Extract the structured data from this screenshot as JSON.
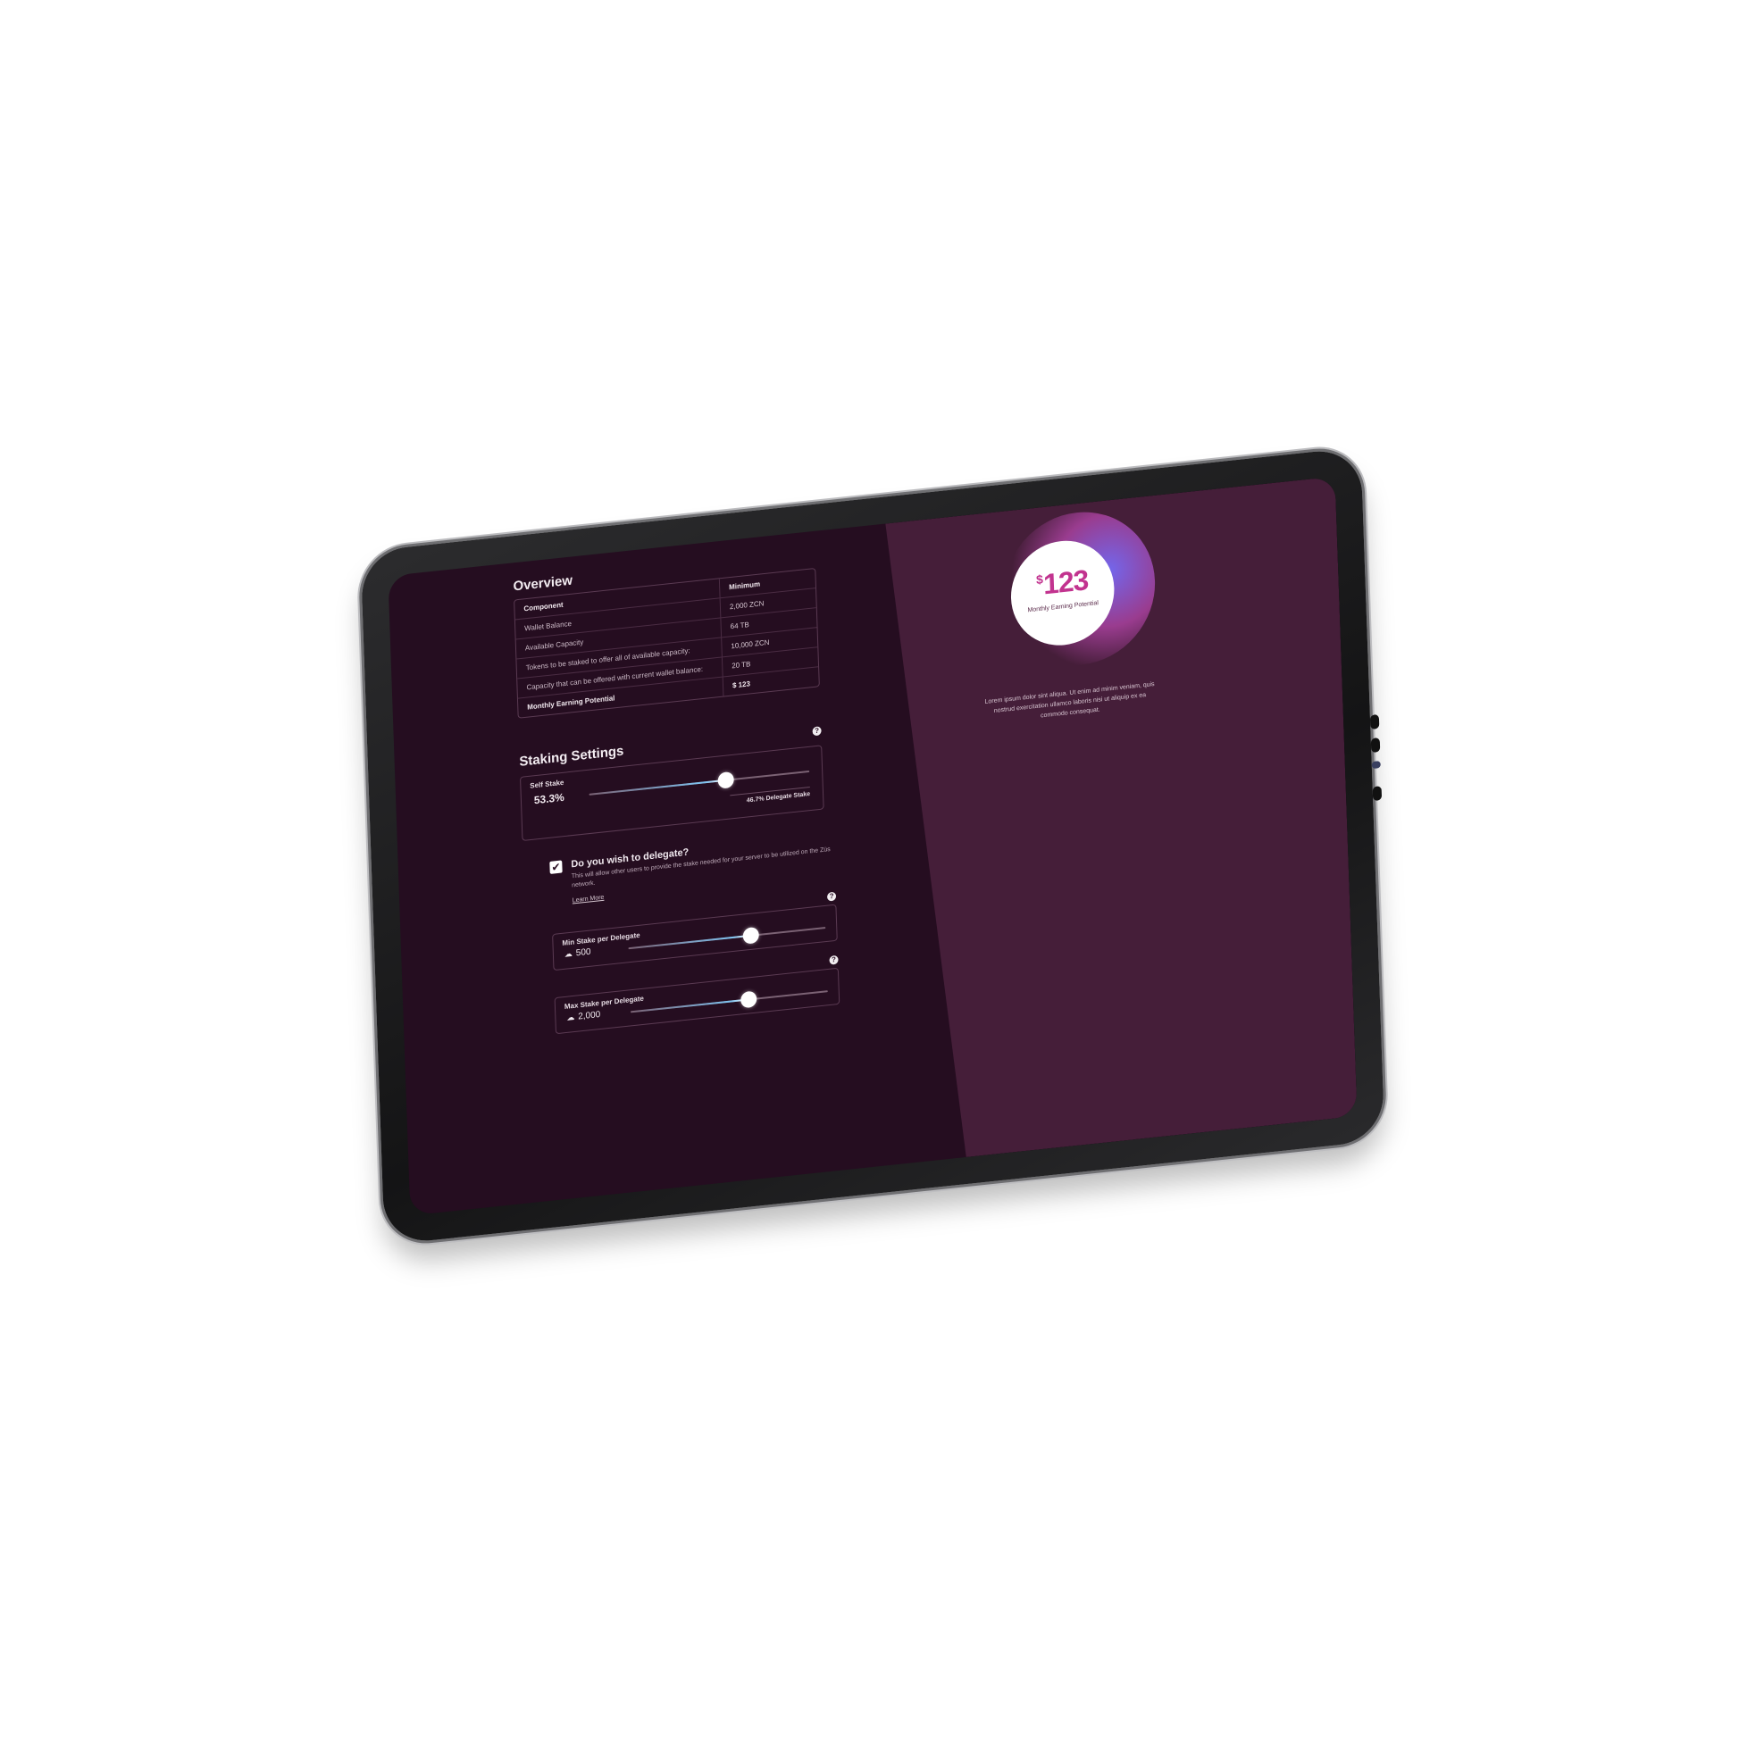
{
  "overview": {
    "title": "Overview",
    "columns": [
      "Component",
      "Minimum"
    ],
    "header_value": "2,000 ZCN",
    "rows": [
      {
        "label": "Wallet Balance",
        "value": "64 TB"
      },
      {
        "label": "Available Capacity",
        "value": ""
      },
      {
        "label": "Tokens to be staked to offer all of available capacity:",
        "value": "10,000 ZCN"
      },
      {
        "label": "Capacity that can be offered with current wallet balance:",
        "value": "20 TB"
      },
      {
        "label": "Monthly Earning Potential",
        "value": "$ 123"
      }
    ]
  },
  "staking": {
    "title": "Staking Settings",
    "help": "?",
    "self_stake": {
      "label": "Self Stake",
      "percent_text": "53.3%",
      "level": 0.62,
      "delegate_text": "46.7% Delegate Stake"
    },
    "delegate_question": {
      "checked": true,
      "check_mark": "✔",
      "title": "Do you wish to delegate?",
      "description": "This will allow other users to provide the stake needed for your server to be utilized on the Züs network.",
      "learn_more": "Learn More"
    },
    "min_stake": {
      "label": "Min Stake per Delegate",
      "value": "500",
      "level": 0.62,
      "icon": "cloud-icon",
      "help": "?"
    },
    "max_stake": {
      "label": "Max Stake per Delegate",
      "value": "2,000",
      "level": 0.6,
      "icon": "cloud-icon",
      "help": "?"
    }
  },
  "earning": {
    "currency": "$",
    "amount": "123",
    "label": "Monthly Earning Potential",
    "description": "Lorem ipsum dolor sint aliqua. Ut enim ad minim veniam, quis nostrud exercitation ullamco laboris nisi ut aliquip ex ea commodo consequat."
  },
  "colors": {
    "screen_bg": "#250d20",
    "right_panel_bg": "#451e39",
    "accent": "#c2338f"
  }
}
